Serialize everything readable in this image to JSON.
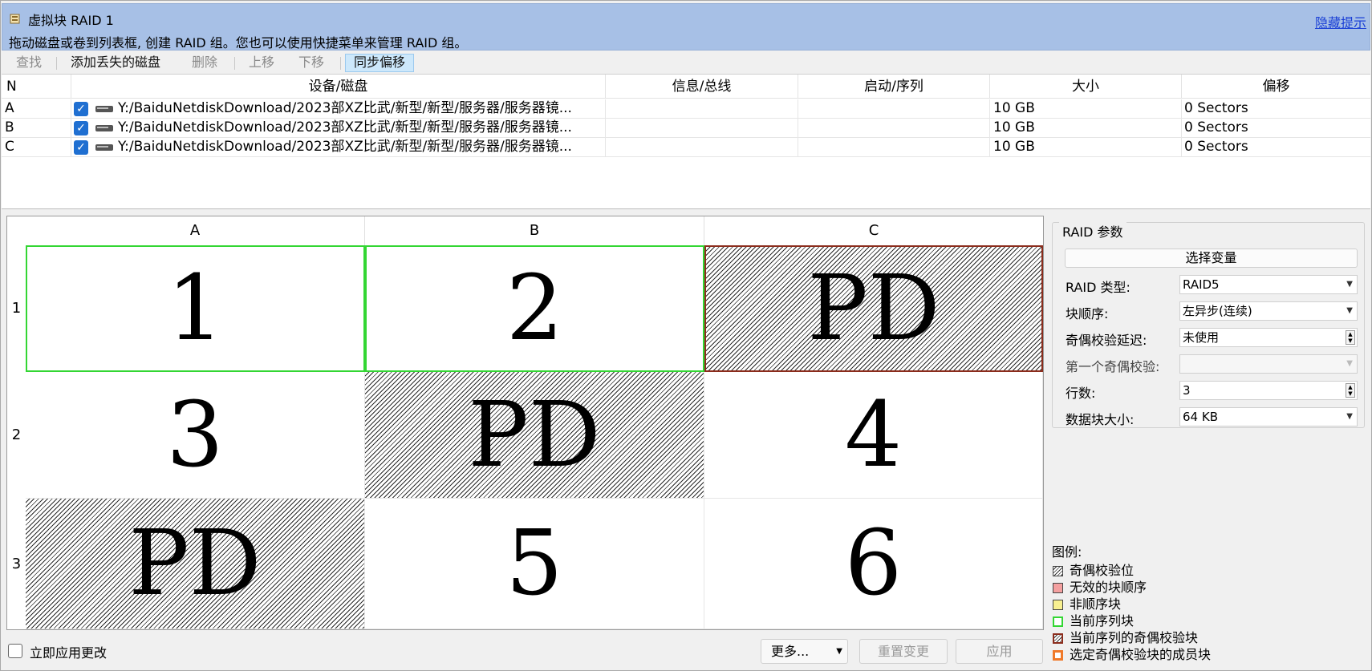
{
  "banner": {
    "title": "虚拟块 RAID 1",
    "hint": "拖动磁盘或卷到列表框, 创建 RAID 组。您也可以使用快捷菜单来管理 RAID 组。",
    "hide_link": "隐藏提示"
  },
  "toolbar": {
    "find": "查找",
    "add_lost": "添加丢失的磁盘",
    "delete": "删除",
    "move_up": "上移",
    "move_down": "下移",
    "sync_offset": "同步偏移"
  },
  "table": {
    "headers": [
      "N",
      "设备/磁盘",
      "信息/总线",
      "启动/序列",
      "大小",
      "偏移"
    ],
    "rows": [
      {
        "n": "A",
        "device": "Y:/BaiduNetdiskDownload/2023部XZ比武/新型/新型/服务器/服务器镜...",
        "info": "",
        "boot": "",
        "size": "10 GB",
        "offset": "0 Sectors"
      },
      {
        "n": "B",
        "device": "Y:/BaiduNetdiskDownload/2023部XZ比武/新型/新型/服务器/服务器镜...",
        "info": "",
        "boot": "",
        "size": "10 GB",
        "offset": "0 Sectors"
      },
      {
        "n": "C",
        "device": "Y:/BaiduNetdiskDownload/2023部XZ比武/新型/新型/服务器/服务器镜...",
        "info": "",
        "boot": "",
        "size": "10 GB",
        "offset": "0 Sectors"
      }
    ]
  },
  "grid": {
    "columns": [
      "A",
      "B",
      "C"
    ],
    "rows": [
      "1",
      "2",
      "3"
    ],
    "cells": [
      [
        {
          "text": "1",
          "state": "current"
        },
        {
          "text": "2",
          "state": "current"
        },
        {
          "text": "PD",
          "state": "current-parity"
        }
      ],
      [
        {
          "text": "3",
          "state": "normal"
        },
        {
          "text": "PD",
          "state": "parity"
        },
        {
          "text": "4",
          "state": "normal"
        }
      ],
      [
        {
          "text": "PD",
          "state": "parity"
        },
        {
          "text": "5",
          "state": "normal"
        },
        {
          "text": "6",
          "state": "normal"
        }
      ]
    ]
  },
  "raid_params": {
    "group_title": "RAID 参数",
    "select_variable": "选择变量",
    "fields": [
      {
        "label": "RAID 类型:",
        "value": "RAID5",
        "control": "dropdown"
      },
      {
        "label": "块顺序:",
        "value": "左异步(连续)",
        "control": "dropdown"
      },
      {
        "label": "奇偶校验延迟:",
        "value": "未使用",
        "control": "spinner"
      },
      {
        "label": "第一个奇偶校验:",
        "value": "",
        "control": "dropdown-disabled"
      },
      {
        "label": "行数:",
        "value": "3",
        "control": "spinner"
      },
      {
        "label": "数据块大小:",
        "value": "64 KB",
        "control": "dropdown"
      }
    ]
  },
  "legend": {
    "title": "图例:",
    "items": [
      {
        "label": "奇偶校验位",
        "swatch": "hatch",
        "color": "#ffffff"
      },
      {
        "label": "无效的块顺序",
        "swatch": "fill",
        "color": "#f4a0a0"
      },
      {
        "label": "非顺序块",
        "swatch": "fill",
        "color": "#f8f090"
      },
      {
        "label": "当前序列块",
        "swatch": "border",
        "color": "#33d633"
      },
      {
        "label": "当前序列的奇偶校验块",
        "swatch": "hatch-border",
        "color": "#8b2c1c"
      },
      {
        "label": "选定奇偶校验块的成员块",
        "swatch": "border",
        "color": "#f07a2a"
      }
    ]
  },
  "bottom": {
    "apply_now": "立即应用更改",
    "more": "更多...",
    "reset": "重置变更",
    "apply": "应用"
  },
  "colors": {
    "banner_bg": "#a7c0e6",
    "current_border": "#33d633",
    "current_parity_border": "#8b2c1c",
    "checkbox": "#1f6fd1",
    "link": "#1a3fd6"
  }
}
